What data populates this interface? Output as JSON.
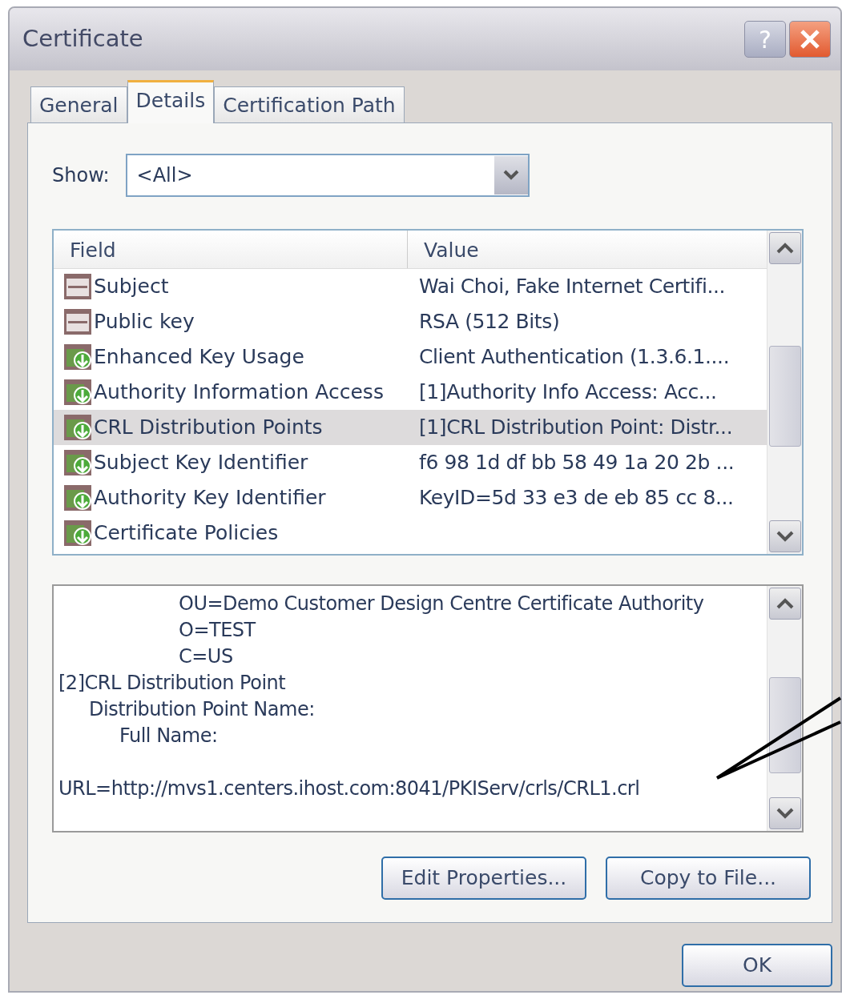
{
  "window": {
    "title": "Certificate",
    "help_button": "?"
  },
  "tabs": [
    {
      "label": "General",
      "selected": false
    },
    {
      "label": "Details",
      "selected": true
    },
    {
      "label": "Certification Path",
      "selected": false
    }
  ],
  "show": {
    "label": "Show:",
    "value": "<All>"
  },
  "fields_list": {
    "columns": [
      "Field",
      "Value"
    ],
    "rows": [
      {
        "kind": "plain",
        "field": "Subject",
        "value": "Wai Choi, Fake Internet Certifi...",
        "selected": false
      },
      {
        "kind": "plain",
        "field": "Public key",
        "value": "RSA (512 Bits)",
        "selected": false
      },
      {
        "kind": "extension",
        "field": "Enhanced Key Usage",
        "value": "Client Authentication (1.3.6.1....",
        "selected": false
      },
      {
        "kind": "extension",
        "field": "Authority Information Access",
        "value": "[1]Authority Info Access: Acc...",
        "selected": false
      },
      {
        "kind": "extension",
        "field": "CRL Distribution Points",
        "value": "[1]CRL Distribution Point: Distr...",
        "selected": true
      },
      {
        "kind": "extension",
        "field": "Subject Key Identifier",
        "value": "f6 98 1d df bb 58 49 1a 20 2b ...",
        "selected": false
      },
      {
        "kind": "extension",
        "field": "Authority Key Identifier",
        "value": "KeyID=5d 33 e3 de eb 85 cc 8...",
        "selected": false
      },
      {
        "kind": "extension",
        "field": "Certificate Policies",
        "selected": false
      }
    ]
  },
  "detail_text": {
    "lines": [
      {
        "text": "OU=Demo Customer Design Centre Certificate Authority"
      },
      {
        "text": "O=TEST"
      },
      {
        "text": "C=US"
      },
      {
        "text": "[2]CRL Distribution Point",
        "children": [
          {
            "text": "Distribution Point Name:",
            "children": [
              {
                "text": "Full Name:"
              }
            ]
          }
        ]
      }
    ],
    "url_line": "URL=http://mvs1.centers.ihost.com:8041/PKIServ/crls/CRL1.crl"
  },
  "buttons": [
    "Edit Properties...",
    "Copy to File..."
  ],
  "ok_button": "OK"
}
